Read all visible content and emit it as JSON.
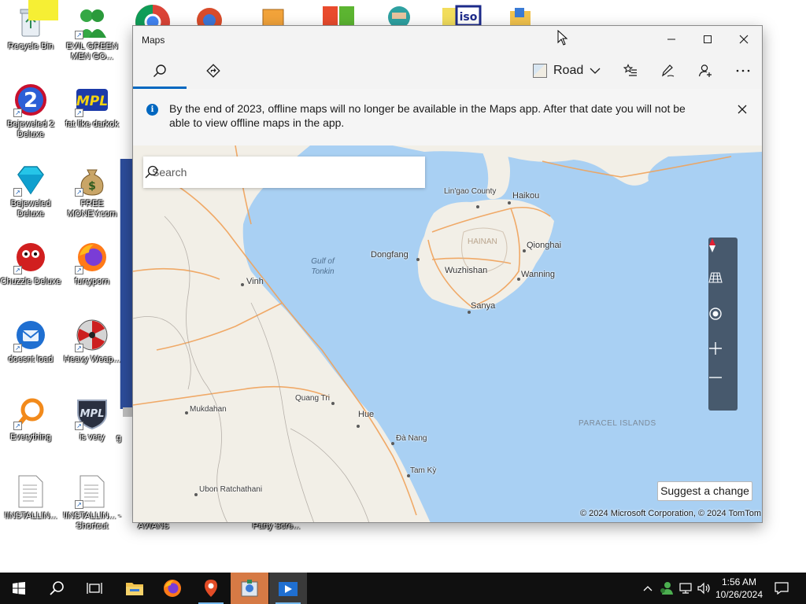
{
  "desktop": {
    "icons": [
      {
        "label": "Recycle Bin",
        "icon": "recycle-bin-icon"
      },
      {
        "label": "EVIL GREEN MEN GO...",
        "icon": "green-men-icon"
      },
      {
        "label": "Bejeweled 2 Deluxe",
        "icon": "bejeweled2-icon"
      },
      {
        "label": "fat like darkok",
        "icon": "mpl-icon"
      },
      {
        "label": "Bejeweled Deluxe",
        "icon": "diamond-icon"
      },
      {
        "label": "FREE MONEY.com",
        "icon": "money-bag-icon"
      },
      {
        "label": "Chuzzle Deluxe",
        "icon": "chuzzle-icon"
      },
      {
        "label": "furryporn",
        "icon": "firefox-icon"
      },
      {
        "label": "doesnt load",
        "icon": "thunderbird-icon"
      },
      {
        "label": "Heavy Weap...",
        "icon": "heavy-weapon-icon"
      },
      {
        "label": "Everything",
        "icon": "everything-search-icon"
      },
      {
        "label": "is very",
        "icon": "mpl-shield-icon"
      },
      {
        "label": "!INSTALLIN...",
        "icon": "document-icon"
      },
      {
        "label": "!INSTALLIN... - Shortcut",
        "icon": "document-icon"
      },
      {
        "label": "AVIANS",
        "icon": "avians-icon"
      },
      {
        "label": "Party Scre...",
        "icon": "party-screen-icon"
      }
    ],
    "partial_label_g": "g"
  },
  "maps_window": {
    "title": "Maps",
    "toolbar": {
      "search_tab_icon": "search-icon",
      "directions_tab_icon": "directions-icon",
      "map_style_label": "Road",
      "favorites_icon": "favorites-icon",
      "ink_icon": "ink-pen-icon",
      "account_icon": "account-add-icon",
      "more_icon": "more-icon"
    },
    "banner": {
      "message": "By the end of 2023, offline maps will no longer be available in the Maps app. After that date you will not be able to view offline maps in the app."
    },
    "search": {
      "placeholder": "Search"
    },
    "map_labels": {
      "lingao": "Lin'gao County",
      "haikou": "Haikou",
      "dongfang": "Dongfang",
      "qionghai": "Qionghai",
      "wuzhishan": "Wuzhishan",
      "wanning": "Wanning",
      "sanya": "Sanya",
      "gulf": "Gulf of Tonkin",
      "vinh": "Vinh",
      "quang_tri": "Quang Tri",
      "hue": "Hue",
      "da_nang": "Đà Nang",
      "tam_ky": "Tam Kỳ",
      "mukdahan": "Mukdahan",
      "ubon": "Ubon Ratchathani",
      "paracel": "PARACEL ISLANDS",
      "hainan": "HAINAN"
    },
    "map_controls": [
      "compass-icon",
      "map-3d-icon",
      "locate-me-icon",
      "zoom-in-icon",
      "zoom-out-icon"
    ],
    "suggest_change": "Suggest a change",
    "copyright": "© 2024 Microsoft Corporation, © 2024 TomTom"
  },
  "taskbar": {
    "apps": [
      "start-icon",
      "search-icon",
      "task-view-icon",
      "file-explorer-icon",
      "firefox-icon",
      "maps-icon",
      "photos-icon",
      "media-player-icon"
    ],
    "tray_icons": [
      "chevron-up-icon",
      "user-status-icon",
      "network-icon",
      "volume-icon"
    ],
    "time": "1:56 AM",
    "date": "10/26/2024",
    "notification_icon": "notification-icon"
  },
  "colors": {
    "accent": "#0067c0",
    "water": "#a9d0f3",
    "land": "#f2efe7",
    "road": "#f0a25a",
    "taskbar": "#101010"
  }
}
